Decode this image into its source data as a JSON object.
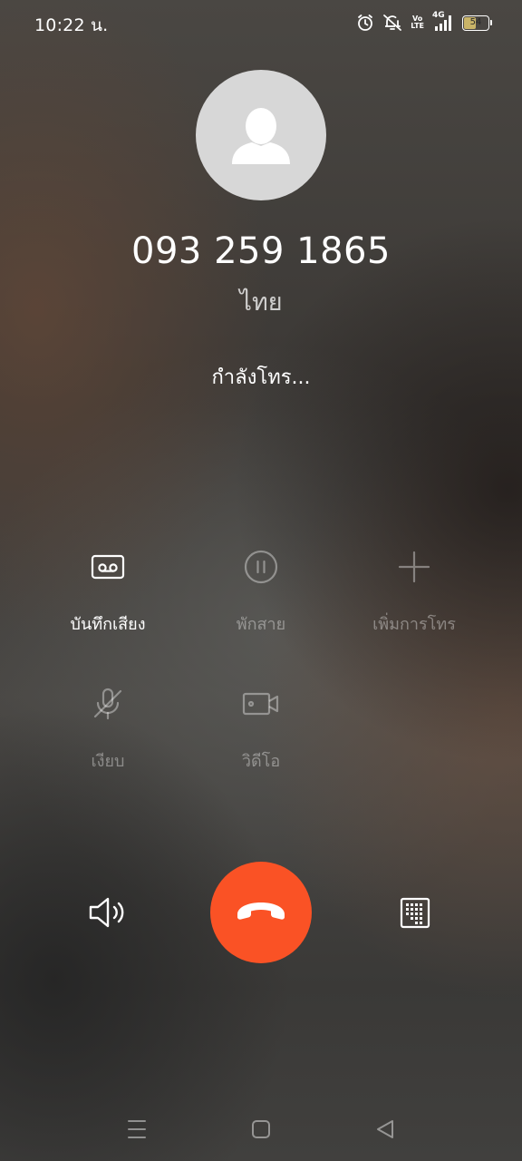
{
  "status_bar": {
    "time": "10:22 น.",
    "network": "4G",
    "volte_top": "Vo",
    "volte_bottom": "LTE",
    "battery_level": "54",
    "battery_fraction": 0.54,
    "icons": [
      "alarm-icon",
      "mute-icon",
      "volte-icon",
      "signal-icon",
      "battery-icon"
    ]
  },
  "contact": {
    "avatar_icon": "person-icon",
    "phone_number": "093 259 1865",
    "location": "ไทย"
  },
  "call": {
    "status": "กำลังโทร..."
  },
  "actions": [
    {
      "label": "บันทึกเสียง",
      "icon": "record-icon",
      "enabled": true
    },
    {
      "label": "พักสาย",
      "icon": "pause-icon",
      "enabled": false
    },
    {
      "label": "เพิ่มการโทร",
      "icon": "add-call-icon",
      "enabled": false
    },
    {
      "label": "เงียบ",
      "icon": "mic-off-icon",
      "enabled": false
    },
    {
      "label": "วิดีโอ",
      "icon": "video-icon",
      "enabled": false
    }
  ],
  "controls": {
    "speaker_icon": "speaker-icon",
    "end_call_icon": "end-call-icon",
    "keypad_icon": "keypad-icon"
  },
  "navigation": {
    "menu_icon": "menu-icon",
    "home_icon": "home-icon",
    "back_icon": "back-icon"
  },
  "colors": {
    "end_call": "#fa5225",
    "avatar_bg": "#d7d7d7",
    "battery_fill": "#c9b468",
    "text_primary": "#ffffff",
    "text_disabled": "rgba(255,255,255,0.38)"
  }
}
